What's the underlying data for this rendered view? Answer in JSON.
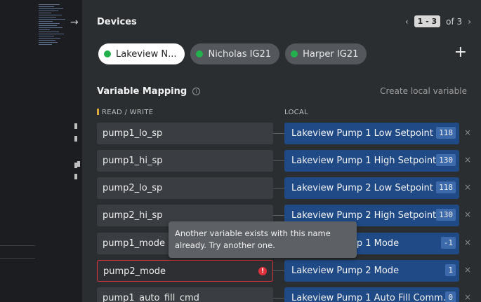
{
  "devices": {
    "title": "Devices",
    "pager": {
      "range": "1 - 3",
      "of": "of 3"
    },
    "chips": [
      {
        "label": "Lakeview N...",
        "active": true
      },
      {
        "label": "Nicholas IG21",
        "active": false
      },
      {
        "label": "Harper IG21",
        "active": false
      }
    ],
    "add_label": "+"
  },
  "mapping": {
    "title": "Variable Mapping",
    "create_local": "Create local variable",
    "col_rw": "READ / WRITE",
    "col_local": "LOCAL",
    "rows": [
      {
        "var": "pump1_lo_sp",
        "local": "Lakeview Pump 1 Low Setpoint",
        "value": "118"
      },
      {
        "var": "pump1_hi_sp",
        "local": "Lakeview Pump 1 High Setpoint",
        "value": "130"
      },
      {
        "var": "pump2_lo_sp",
        "local": "Lakeview Pump 2 Low Setpoint",
        "value": "118"
      },
      {
        "var": "pump2_hi_sp",
        "local": "Lakeview Pump 2 High Setpoint",
        "value": "130"
      },
      {
        "var": "pump1_mode",
        "local": "Lakeview Pump 1 Mode",
        "value": "-1"
      },
      {
        "var": "pump2_mode",
        "local": "Lakeview Pump 2 Mode",
        "value": "1",
        "error": true
      },
      {
        "var": "pump1_auto_fill_cmd",
        "local": "Lakeview Pump 1 Auto Fill Comm...",
        "value": "0"
      }
    ],
    "remove_label": "×",
    "error_icon": "!",
    "tooltip": "Another variable exists with this name already. Try another one."
  },
  "icons": {
    "collapse": "→",
    "prev": "‹",
    "next": "›",
    "info": "i"
  },
  "colors": {
    "status_online": "#22b14c",
    "local_bg": "#1f4a86",
    "error": "#e0303a",
    "rw_marker": "#d9a93a"
  }
}
